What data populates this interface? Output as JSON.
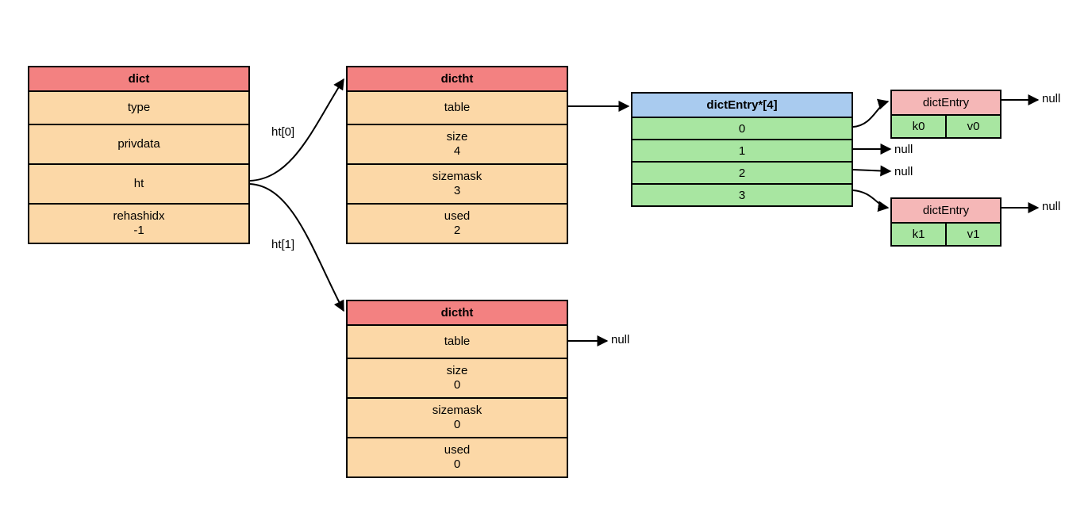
{
  "dict": {
    "title": "dict",
    "fields": {
      "type": "type",
      "privdata": "privdata",
      "ht": "ht",
      "rehashidx_label": "rehashidx",
      "rehashidx_value": "-1"
    }
  },
  "edges": {
    "ht0": "ht[0]",
    "ht1": "ht[1]"
  },
  "dictht0": {
    "title": "dictht",
    "table": "table",
    "size_label": "size",
    "size_value": "4",
    "sizemask_label": "sizemask",
    "sizemask_value": "3",
    "used_label": "used",
    "used_value": "2"
  },
  "dictht1": {
    "title": "dictht",
    "table": "table",
    "size_label": "size",
    "size_value": "0",
    "sizemask_label": "sizemask",
    "sizemask_value": "0",
    "used_label": "used",
    "used_value": "0"
  },
  "entryArray": {
    "title": "dictEntry*[4]",
    "slots": [
      "0",
      "1",
      "2",
      "3"
    ]
  },
  "entry0": {
    "title": "dictEntry",
    "key": "k0",
    "val": "v0"
  },
  "entry1": {
    "title": "dictEntry",
    "key": "k1",
    "val": "v1"
  },
  "nulls": {
    "n0": "null",
    "n1": "null",
    "n2": "null",
    "n3": "null",
    "n4": "null",
    "n5": "null"
  }
}
